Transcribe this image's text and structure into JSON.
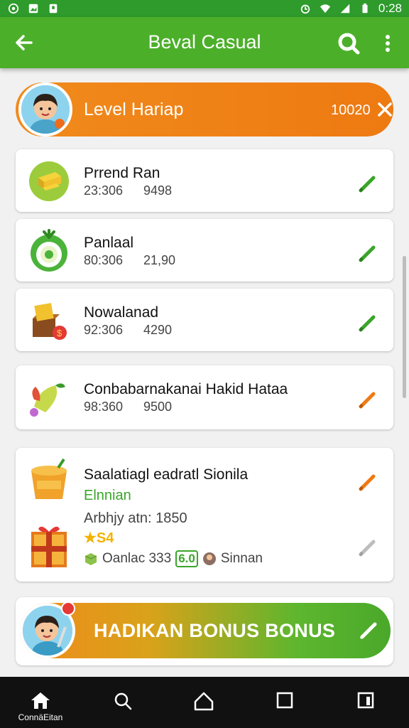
{
  "status_bar": {
    "time": "0:28"
  },
  "app_bar": {
    "title": "Beval Casual"
  },
  "level_banner": {
    "label": "Level Hariap",
    "value": "10020"
  },
  "items": [
    {
      "name": "Prrend Ran",
      "v1": "23:306",
      "v2": "9498",
      "pencil_color": "#3aa52a"
    },
    {
      "name": "Panlaal",
      "v1": "80:306",
      "v2": "21,90",
      "pencil_color": "#3aa52a"
    },
    {
      "name": "Nowalanad",
      "v1": "92:306",
      "v2": "4290",
      "pencil_color": "#3aa52a"
    },
    {
      "name": "Conbabarnakanai Hakid Hataa",
      "v1": "98:360",
      "v2": "9500",
      "pencil_color": "#ee7a12"
    }
  ],
  "big_card": {
    "name": "Saalatiagl eadratl Sionila",
    "subtitle": "Elnnian",
    "arbitrary": "Arbhjy atn: 1850",
    "stars": "★S4",
    "item_text": "Oanlac 333",
    "badge": "6.0",
    "person_text": "Sinnan"
  },
  "bonus": {
    "label": "HADIKAN BONUS BONUS"
  },
  "nav": {
    "home_label": "ConnäEitan"
  },
  "colors": {
    "green": "#4caf2a",
    "orange": "#ee7a12",
    "status": "#2e9b2c"
  }
}
